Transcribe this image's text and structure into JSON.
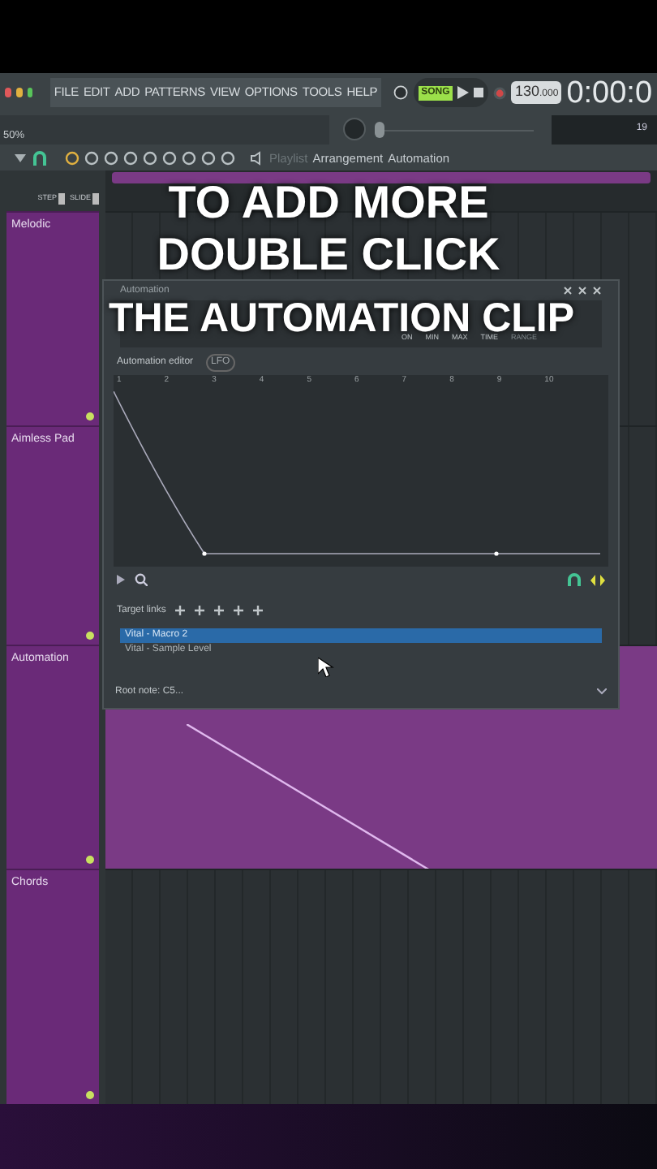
{
  "menu": [
    "FILE",
    "EDIT",
    "ADD",
    "PATTERNS",
    "VIEW",
    "OPTIONS",
    "TOOLS",
    "HELP"
  ],
  "transport": {
    "mode": "SONG",
    "tempo": "130",
    "tempo_fraction": ".000",
    "time": "0:00:0",
    "bar": "19"
  },
  "zoom_level": "50%",
  "pitch_slider": {
    "level": 0.02
  },
  "breadcrumb": [
    {
      "label": "Playlist",
      "selected": false
    },
    {
      "label": "Arrangement",
      "selected": true
    },
    {
      "label": "Automation",
      "selected": true
    }
  ],
  "snap": [
    "STEP",
    "SLIDE"
  ],
  "tracks": [
    {
      "name": "Melodic",
      "kind": "grid"
    },
    {
      "name": "Aimless Pad",
      "kind": "grid"
    },
    {
      "name": "Automation",
      "kind": "clip"
    },
    {
      "name": "Chords",
      "kind": "grid"
    }
  ],
  "dialog": {
    "title": "Automation",
    "knobs": [
      {
        "label": "ON",
        "disabled": false
      },
      {
        "label": "MIN",
        "disabled": false
      },
      {
        "label": "MAX",
        "disabled": false
      },
      {
        "label": "TIME",
        "disabled": false
      },
      {
        "label": "RANGE",
        "disabled": true
      }
    ],
    "editor_label": "Automation editor",
    "lfo": "LFO",
    "ruler": [
      "1",
      "2",
      "3",
      "4",
      "5",
      "6",
      "7",
      "8",
      "9",
      "10"
    ],
    "target_links_label": "Target links",
    "targets": [
      {
        "label": "Vital - Macro 2",
        "selected": true
      },
      {
        "label": "Vital - Sample Level",
        "selected": false
      }
    ],
    "root_note": "Root note: C5..."
  },
  "caption": [
    "TO ADD MORE",
    "DOUBLE CLICK",
    "THE AUTOMATION CLIP"
  ]
}
